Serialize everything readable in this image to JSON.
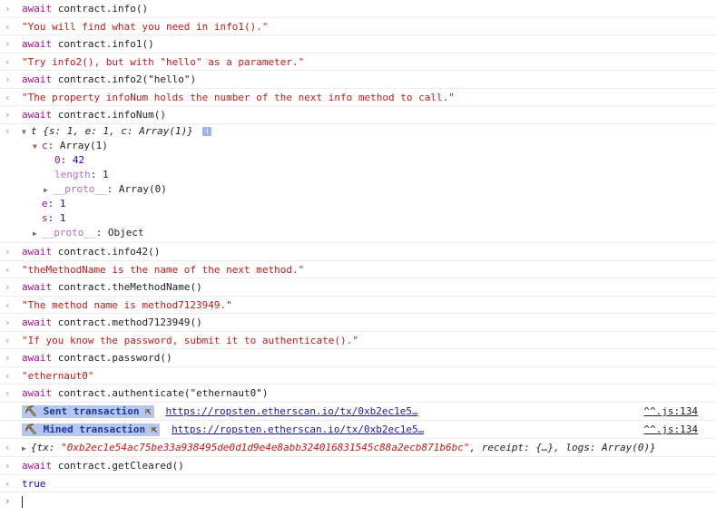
{
  "glyphs": {
    "input": "›",
    "output": "‹",
    "prompt": "›"
  },
  "entries": [
    {
      "cmd": "contract.info()",
      "result": "\"You will find what you need in info1().\""
    },
    {
      "cmd": "contract.info1()",
      "result": "\"Try info2(), but with \"hello\" as a parameter.\""
    },
    {
      "cmd": "contract.info2(\"hello\")",
      "result": "\"The property infoNum holds the number of the next info method to call.\""
    },
    {
      "cmd": "contract.infoNum()"
    }
  ],
  "keyword": "await",
  "object_tree": {
    "summary_prefix": "t",
    "summary": "{s: 1, e: 1, c: Array(1)}",
    "info_icon": "i",
    "c_key": "c",
    "c_type": "Array(1)",
    "c_items": [
      {
        "key": "0",
        "value": "42"
      }
    ],
    "length_key": "length",
    "length_value": "1",
    "c_proto_key": "__proto__",
    "c_proto_value": "Array(0)",
    "e_key": "e",
    "e_value": "1",
    "s_key": "s",
    "s_value": "1",
    "proto_key": "__proto__",
    "proto_value": "Object"
  },
  "entries2": [
    {
      "cmd": "contract.info42()",
      "result": "\"theMethodName is the name of the next method.\""
    },
    {
      "cmd": "contract.theMethodName()",
      "result": "\"The method name is method7123949.\""
    },
    {
      "cmd": "contract.method7123949()",
      "result": "\"If you know the password, submit it to authenticate().\""
    },
    {
      "cmd": "contract.password()",
      "result": "\"ethernaut0\""
    },
    {
      "cmd": "contract.authenticate(\"ethernaut0\")"
    }
  ],
  "transactions": [
    {
      "icon": "⛏",
      "label": "Sent transaction",
      "arrow": "⇱",
      "url": "https://ropsten.etherscan.io/tx/0xb2ec1e5…",
      "source": "^^.js:134"
    },
    {
      "icon": "⛏",
      "label": "Mined transaction",
      "arrow": "⇱",
      "url": "https://ropsten.etherscan.io/tx/0xb2ec1e5…",
      "source": "^^.js:134"
    }
  ],
  "tx_result": {
    "open": "{tx: ",
    "hash": "\"0xb2ec1e54ac75be33a938495de0d1d9e4e8abb324016831545c88a2ecb871b6bc\"",
    "rest": ", receipt: {…}, logs: Array(0)}"
  },
  "final": {
    "cmd": "contract.getCleared()",
    "result": "true"
  }
}
